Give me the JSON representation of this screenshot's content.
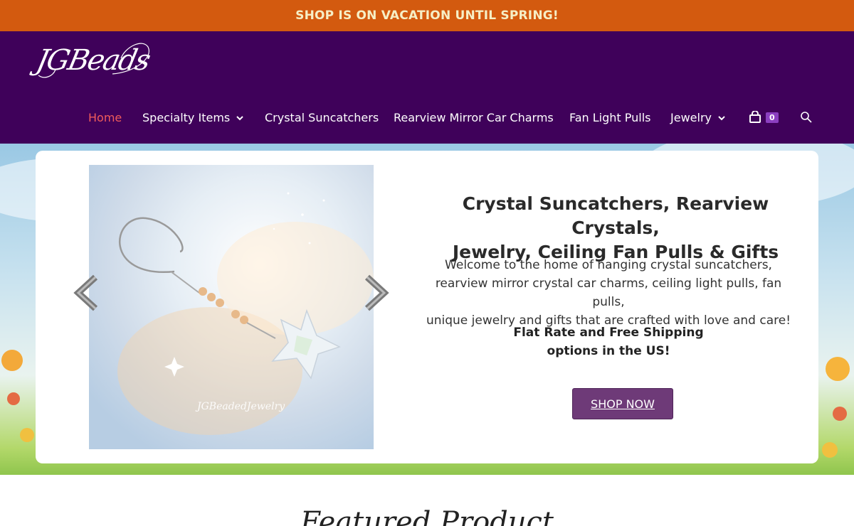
{
  "banner": {
    "text": "SHOP IS ON VACATION UNTIL SPRING!"
  },
  "logo": {
    "text": "JGBeads"
  },
  "nav": {
    "items": [
      {
        "label": "Home",
        "active": true,
        "dropdown": false
      },
      {
        "label": "Specialty Items",
        "active": false,
        "dropdown": true
      },
      {
        "label": "Crystal Suncatchers",
        "active": false,
        "dropdown": false
      },
      {
        "label": "Rearview Mirror Car Charms",
        "active": false,
        "dropdown": false
      },
      {
        "label": "Fan Light Pulls",
        "active": false,
        "dropdown": false
      },
      {
        "label": "Jewelry",
        "active": false,
        "dropdown": true
      }
    ],
    "cart_count": "0"
  },
  "hero": {
    "title_line1": "Crystal Suncatchers, Rearview Crystals,",
    "title_line2": "Jewelry, Ceiling Fan Pulls & Gifts",
    "desc_line1": "Welcome to the home of hanging crystal suncatchers,",
    "desc_line2": "rearview mirror crystal car charms, ceiling light pulls, fan pulls,",
    "desc_line3": "unique jewelry and gifts that are crafted with love and care!",
    "ship_line1": "Flat Rate and Free Shipping",
    "ship_line2": "options in the US!",
    "button": "SHOP NOW",
    "image_watermark": "JGBeadedJewelry"
  },
  "featured": {
    "title": "Featured Product"
  },
  "colors": {
    "banner": "#d35a0f",
    "header": "#3f015a",
    "nav_active": "#f05b5b",
    "button": "#6e3a78",
    "cart_badge": "#8b3fc0"
  }
}
